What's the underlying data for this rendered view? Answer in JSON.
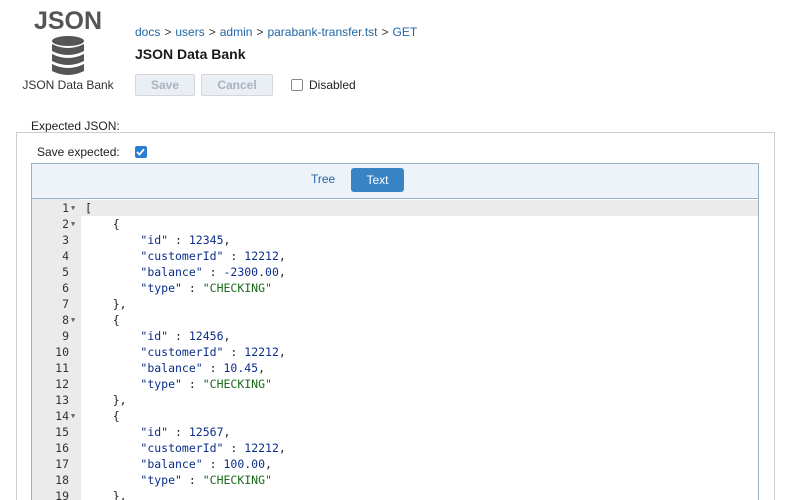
{
  "logo": {
    "word": "JSON",
    "caption": "JSON Data Bank",
    "icon": "database-icon"
  },
  "breadcrumb": [
    {
      "label": "docs"
    },
    {
      "label": "users"
    },
    {
      "label": "admin"
    },
    {
      "label": "parabank-transfer.tst"
    },
    {
      "label": "GET"
    }
  ],
  "breadcrumb_separator": ">",
  "page_title": "JSON Data Bank",
  "toolbar": {
    "save_label": "Save",
    "cancel_label": "Cancel",
    "disabled_label": "Disabled",
    "disabled_checked": false
  },
  "expected_label": "Expected JSON:",
  "save_expected": {
    "label": "Save expected:",
    "checked": true
  },
  "editor": {
    "modes": [
      "Tree",
      "Text"
    ],
    "active_mode": "Text",
    "lines": [
      {
        "n": "1",
        "fold": true,
        "tokens": [
          [
            "punc",
            "["
          ]
        ]
      },
      {
        "n": "2",
        "fold": true,
        "tokens": [
          [
            "punc",
            "    {"
          ]
        ]
      },
      {
        "n": "3",
        "fold": false,
        "tokens": [
          [
            "punc",
            "        "
          ],
          [
            "key",
            "\"id\""
          ],
          [
            "punc",
            " : "
          ],
          [
            "num",
            "12345"
          ],
          [
            "punc",
            ","
          ]
        ]
      },
      {
        "n": "4",
        "fold": false,
        "tokens": [
          [
            "punc",
            "        "
          ],
          [
            "key",
            "\"customerId\""
          ],
          [
            "punc",
            " : "
          ],
          [
            "num",
            "12212"
          ],
          [
            "punc",
            ","
          ]
        ]
      },
      {
        "n": "5",
        "fold": false,
        "tokens": [
          [
            "punc",
            "        "
          ],
          [
            "key",
            "\"balance\""
          ],
          [
            "punc",
            " : "
          ],
          [
            "num",
            "-2300.00"
          ],
          [
            "punc",
            ","
          ]
        ]
      },
      {
        "n": "6",
        "fold": false,
        "tokens": [
          [
            "punc",
            "        "
          ],
          [
            "key",
            "\"type\""
          ],
          [
            "punc",
            " : "
          ],
          [
            "str",
            "\"CHECKING\""
          ]
        ]
      },
      {
        "n": "7",
        "fold": false,
        "tokens": [
          [
            "punc",
            "    },"
          ]
        ]
      },
      {
        "n": "8",
        "fold": true,
        "tokens": [
          [
            "punc",
            "    {"
          ]
        ]
      },
      {
        "n": "9",
        "fold": false,
        "tokens": [
          [
            "punc",
            "        "
          ],
          [
            "key",
            "\"id\""
          ],
          [
            "punc",
            " : "
          ],
          [
            "num",
            "12456"
          ],
          [
            "punc",
            ","
          ]
        ]
      },
      {
        "n": "10",
        "fold": false,
        "tokens": [
          [
            "punc",
            "        "
          ],
          [
            "key",
            "\"customerId\""
          ],
          [
            "punc",
            " : "
          ],
          [
            "num",
            "12212"
          ],
          [
            "punc",
            ","
          ]
        ]
      },
      {
        "n": "11",
        "fold": false,
        "tokens": [
          [
            "punc",
            "        "
          ],
          [
            "key",
            "\"balance\""
          ],
          [
            "punc",
            " : "
          ],
          [
            "num",
            "10.45"
          ],
          [
            "punc",
            ","
          ]
        ]
      },
      {
        "n": "12",
        "fold": false,
        "tokens": [
          [
            "punc",
            "        "
          ],
          [
            "key",
            "\"type\""
          ],
          [
            "punc",
            " : "
          ],
          [
            "str",
            "\"CHECKING\""
          ]
        ]
      },
      {
        "n": "13",
        "fold": false,
        "tokens": [
          [
            "punc",
            "    },"
          ]
        ]
      },
      {
        "n": "14",
        "fold": true,
        "tokens": [
          [
            "punc",
            "    {"
          ]
        ]
      },
      {
        "n": "15",
        "fold": false,
        "tokens": [
          [
            "punc",
            "        "
          ],
          [
            "key",
            "\"id\""
          ],
          [
            "punc",
            " : "
          ],
          [
            "num",
            "12567"
          ],
          [
            "punc",
            ","
          ]
        ]
      },
      {
        "n": "16",
        "fold": false,
        "tokens": [
          [
            "punc",
            "        "
          ],
          [
            "key",
            "\"customerId\""
          ],
          [
            "punc",
            " : "
          ],
          [
            "num",
            "12212"
          ],
          [
            "punc",
            ","
          ]
        ]
      },
      {
        "n": "17",
        "fold": false,
        "tokens": [
          [
            "punc",
            "        "
          ],
          [
            "key",
            "\"balance\""
          ],
          [
            "punc",
            " : "
          ],
          [
            "num",
            "100.00"
          ],
          [
            "punc",
            ","
          ]
        ]
      },
      {
        "n": "18",
        "fold": false,
        "tokens": [
          [
            "punc",
            "        "
          ],
          [
            "key",
            "\"type\""
          ],
          [
            "punc",
            " : "
          ],
          [
            "str",
            "\"CHECKING\""
          ]
        ]
      },
      {
        "n": "19",
        "fold": false,
        "tokens": [
          [
            "punc",
            "    },"
          ]
        ]
      }
    ]
  },
  "colors": {
    "link": "#2166a5",
    "accent_button": "#3883c4",
    "checkbox_checked": "#2a7fd4",
    "json_key": "#0b2e8a",
    "json_number": "#0b2e8a",
    "json_string": "#1a6b1a",
    "gutter": "#ebebeb"
  }
}
